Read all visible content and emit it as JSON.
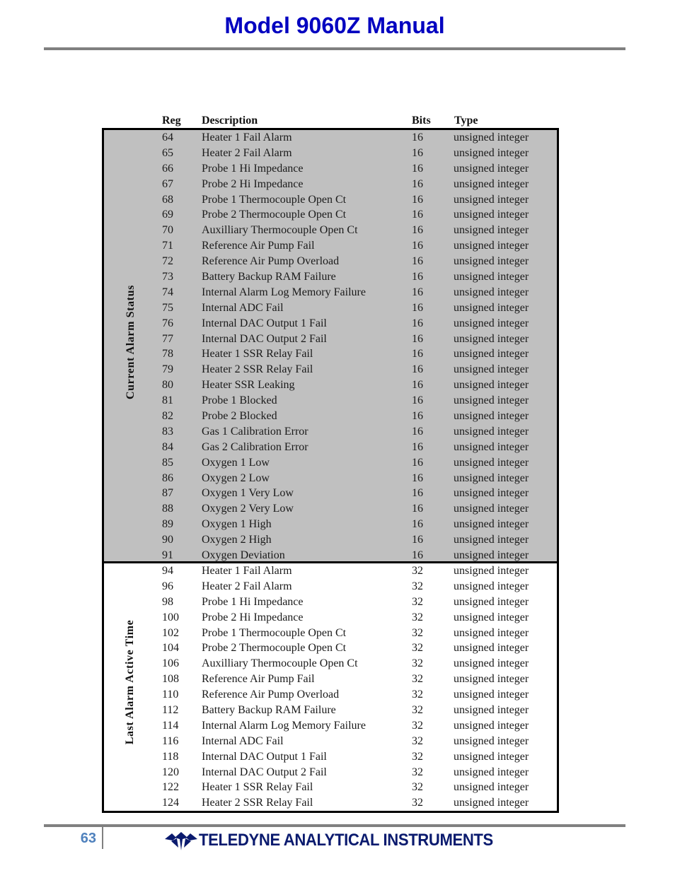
{
  "header": {
    "title": "Model 9060Z Manual"
  },
  "table": {
    "columns": {
      "reg": "Reg",
      "description": "Description",
      "bits": "Bits",
      "type": "Type"
    },
    "sections": [
      {
        "label": "Current Alarm Status",
        "rows": [
          {
            "reg": "64",
            "description": "Heater 1 Fail Alarm",
            "bits": "16",
            "type": "unsigned integer"
          },
          {
            "reg": "65",
            "description": "Heater 2 Fail Alarm",
            "bits": "16",
            "type": "unsigned integer"
          },
          {
            "reg": "66",
            "description": "Probe 1 Hi Impedance",
            "bits": "16",
            "type": "unsigned integer"
          },
          {
            "reg": "67",
            "description": "Probe 2 Hi Impedance",
            "bits": "16",
            "type": "unsigned integer"
          },
          {
            "reg": "68",
            "description": "Probe 1 Thermocouple Open Ct",
            "bits": "16",
            "type": "unsigned integer"
          },
          {
            "reg": "69",
            "description": "Probe 2 Thermocouple Open Ct",
            "bits": "16",
            "type": "unsigned integer"
          },
          {
            "reg": "70",
            "description": "Auxilliary Thermocouple Open Ct",
            "bits": "16",
            "type": "unsigned integer"
          },
          {
            "reg": "71",
            "description": "Reference Air Pump Fail",
            "bits": "16",
            "type": "unsigned integer"
          },
          {
            "reg": "72",
            "description": "Reference Air Pump Overload",
            "bits": "16",
            "type": "unsigned integer"
          },
          {
            "reg": "73",
            "description": "Battery Backup RAM Failure",
            "bits": "16",
            "type": "unsigned integer"
          },
          {
            "reg": "74",
            "description": "Internal Alarm Log Memory Failure",
            "bits": "16",
            "type": "unsigned integer"
          },
          {
            "reg": "75",
            "description": "Internal ADC Fail",
            "bits": "16",
            "type": "unsigned integer"
          },
          {
            "reg": "76",
            "description": "Internal DAC Output 1 Fail",
            "bits": "16",
            "type": "unsigned integer"
          },
          {
            "reg": "77",
            "description": "Internal DAC Output 2 Fail",
            "bits": "16",
            "type": "unsigned integer"
          },
          {
            "reg": "78",
            "description": "Heater 1 SSR Relay Fail",
            "bits": "16",
            "type": "unsigned integer"
          },
          {
            "reg": "79",
            "description": "Heater 2 SSR Relay Fail",
            "bits": "16",
            "type": "unsigned integer"
          },
          {
            "reg": "80",
            "description": "Heater SSR Leaking",
            "bits": "16",
            "type": "unsigned integer"
          },
          {
            "reg": "81",
            "description": "Probe 1 Blocked",
            "bits": "16",
            "type": "unsigned integer"
          },
          {
            "reg": "82",
            "description": "Probe 2 Blocked",
            "bits": "16",
            "type": "unsigned integer"
          },
          {
            "reg": "83",
            "description": "Gas 1 Calibration Error",
            "bits": "16",
            "type": "unsigned integer"
          },
          {
            "reg": "84",
            "description": "Gas 2 Calibration Error",
            "bits": "16",
            "type": "unsigned integer"
          },
          {
            "reg": "85",
            "description": "Oxygen 1 Low",
            "bits": "16",
            "type": "unsigned integer"
          },
          {
            "reg": "86",
            "description": "Oxygen 2 Low",
            "bits": "16",
            "type": "unsigned integer"
          },
          {
            "reg": "87",
            "description": "Oxygen 1 Very Low",
            "bits": "16",
            "type": "unsigned integer"
          },
          {
            "reg": "88",
            "description": "Oxygen 2 Very Low",
            "bits": "16",
            "type": "unsigned integer"
          },
          {
            "reg": "89",
            "description": "Oxygen 1 High",
            "bits": "16",
            "type": "unsigned integer"
          },
          {
            "reg": "90",
            "description": "Oxygen 2 High",
            "bits": "16",
            "type": "unsigned integer"
          },
          {
            "reg": "91",
            "description": "Oxygen Deviation",
            "bits": "16",
            "type": "unsigned integer"
          }
        ]
      },
      {
        "label": "Last Alarm Active Time",
        "rows": [
          {
            "reg": "94",
            "description": "Heater 1 Fail Alarm",
            "bits": "32",
            "type": "unsigned integer"
          },
          {
            "reg": "96",
            "description": "Heater 2 Fail Alarm",
            "bits": "32",
            "type": "unsigned integer"
          },
          {
            "reg": "98",
            "description": "Probe 1 Hi Impedance",
            "bits": "32",
            "type": "unsigned integer"
          },
          {
            "reg": "100",
            "description": "Probe 2 Hi Impedance",
            "bits": "32",
            "type": "unsigned integer"
          },
          {
            "reg": "102",
            "description": "Probe 1 Thermocouple Open Ct",
            "bits": "32",
            "type": "unsigned integer"
          },
          {
            "reg": "104",
            "description": "Probe 2 Thermocouple Open Ct",
            "bits": "32",
            "type": "unsigned integer"
          },
          {
            "reg": "106",
            "description": "Auxilliary Thermocouple Open Ct",
            "bits": "32",
            "type": "unsigned integer"
          },
          {
            "reg": "108",
            "description": "Reference Air Pump Fail",
            "bits": "32",
            "type": "unsigned integer"
          },
          {
            "reg": "110",
            "description": "Reference Air Pump Overload",
            "bits": "32",
            "type": "unsigned integer"
          },
          {
            "reg": "112",
            "description": "Battery Backup RAM Failure",
            "bits": "32",
            "type": "unsigned integer"
          },
          {
            "reg": "114",
            "description": "Internal Alarm Log Memory Failure",
            "bits": "32",
            "type": "unsigned integer"
          },
          {
            "reg": "116",
            "description": "Internal ADC Fail",
            "bits": "32",
            "type": "unsigned integer"
          },
          {
            "reg": "118",
            "description": "Internal DAC Output 1 Fail",
            "bits": "32",
            "type": "unsigned integer"
          },
          {
            "reg": "120",
            "description": "Internal DAC Output 2 Fail",
            "bits": "32",
            "type": "unsigned integer"
          },
          {
            "reg": "122",
            "description": "Heater 1 SSR Relay Fail",
            "bits": "32",
            "type": "unsigned integer"
          },
          {
            "reg": "124",
            "description": "Heater 2 SSR Relay Fail",
            "bits": "32",
            "type": "unsigned integer"
          }
        ]
      }
    ]
  },
  "footer": {
    "page_number": "63",
    "brand_name": "TELEDYNE ANALYTICAL INSTRUMENTS",
    "brand_logo_icon": "teledyne-logo-icon"
  },
  "colors": {
    "title": "#0000c0",
    "rule": "#808080",
    "current_section_bg": "#c0c0c0",
    "page_number": "#4f81bd",
    "brand": "#0a1a6e"
  }
}
